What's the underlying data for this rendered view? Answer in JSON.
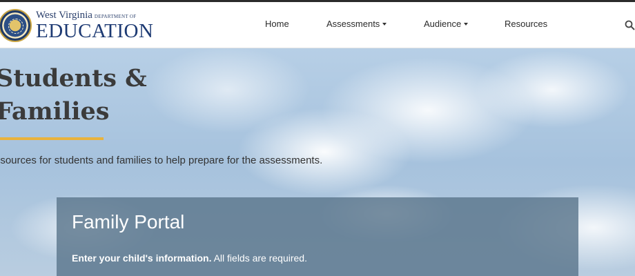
{
  "header": {
    "logo": {
      "state": "West Virginia",
      "department": "DEPARTMENT OF",
      "name": "EDUCATION"
    },
    "nav": {
      "home": "Home",
      "assessments": "Assessments",
      "audience": "Audience",
      "resources": "Resources"
    }
  },
  "hero": {
    "title_line1": "Students &",
    "title_line2": "Families",
    "subtitle": "esources for students and families to help prepare for the assessments."
  },
  "portal": {
    "title": "Family Portal",
    "instruction_bold": "Enter your child's information.",
    "instruction_rest": " All fields are required."
  },
  "colors": {
    "accent_underline": "#e8b33d",
    "brand_blue": "#1d3a73",
    "portal_panel": "#5c768c"
  },
  "icons": {
    "search": "search-icon",
    "seal": "state-seal-icon"
  }
}
